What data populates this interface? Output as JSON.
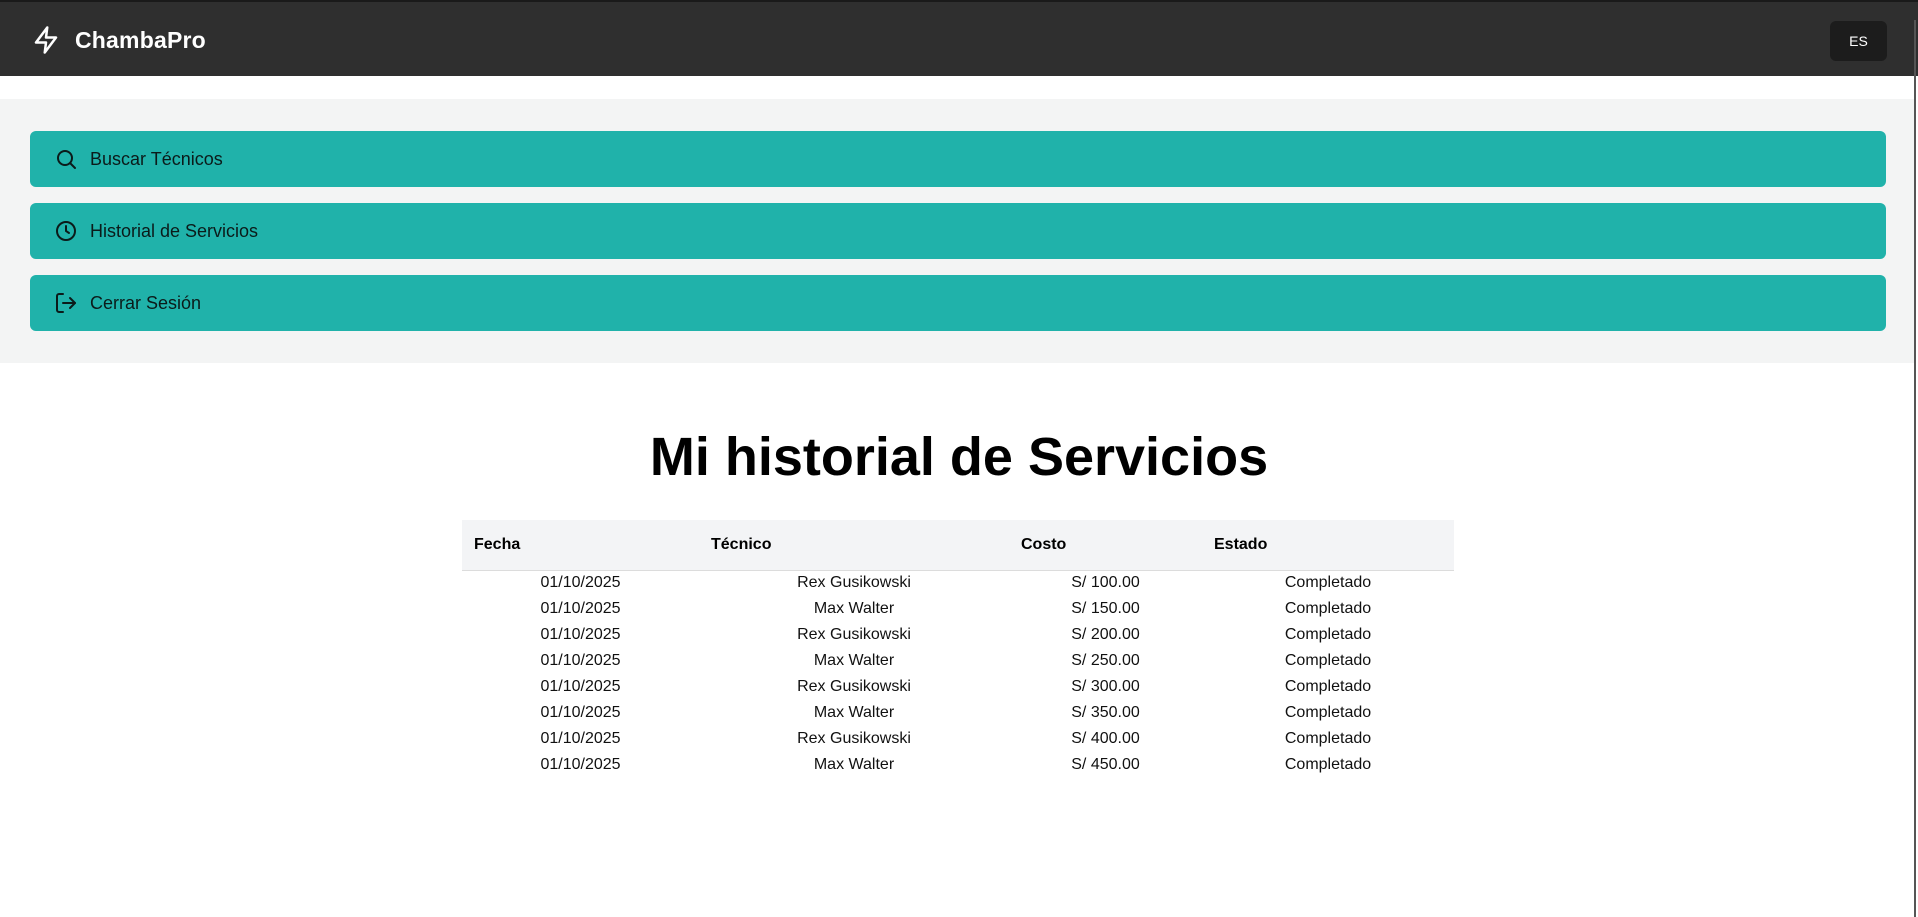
{
  "header": {
    "brand": "ChambaPro",
    "brand_icon": "lightning-icon",
    "language": "ES"
  },
  "nav": {
    "items": [
      {
        "label": "Buscar Técnicos",
        "icon": "search-icon"
      },
      {
        "label": "Historial de Servicios",
        "icon": "clock-icon"
      },
      {
        "label": "Cerrar Sesión",
        "icon": "logout-icon"
      }
    ],
    "accent": "#20b2aa"
  },
  "main": {
    "title": "Mi historial de Servicios",
    "table": {
      "headers": [
        "Fecha",
        "Técnico",
        "Costo",
        "Estado"
      ],
      "rows": [
        [
          "01/10/2025",
          "Rex Gusikowski",
          "S/ 100.00",
          "Completado"
        ],
        [
          "01/10/2025",
          "Max Walter",
          "S/ 150.00",
          "Completado"
        ],
        [
          "01/10/2025",
          "Rex Gusikowski",
          "S/ 200.00",
          "Completado"
        ],
        [
          "01/10/2025",
          "Max Walter",
          "S/ 250.00",
          "Completado"
        ],
        [
          "01/10/2025",
          "Rex Gusikowski",
          "S/ 300.00",
          "Completado"
        ],
        [
          "01/10/2025",
          "Max Walter",
          "S/ 350.00",
          "Completado"
        ],
        [
          "01/10/2025",
          "Rex Gusikowski",
          "S/ 400.00",
          "Completado"
        ],
        [
          "01/10/2025",
          "Max Walter",
          "S/ 450.00",
          "Completado"
        ]
      ]
    }
  }
}
